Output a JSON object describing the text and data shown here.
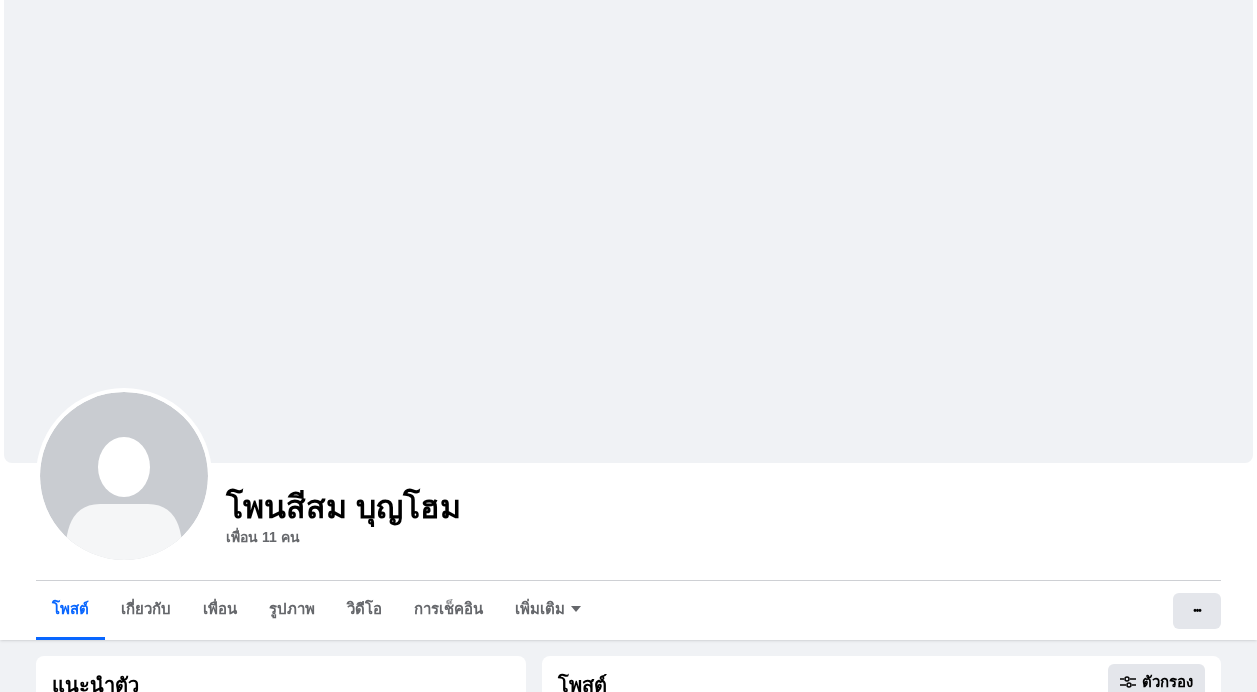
{
  "profile": {
    "name": "โพนสีสม บุญโฮม",
    "friends_count": "เพื่อน 11 คน"
  },
  "tabs": [
    {
      "label": "โพสต์",
      "selected": true
    },
    {
      "label": "เกี่ยวกับ",
      "selected": false
    },
    {
      "label": "เพื่อน",
      "selected": false
    },
    {
      "label": "รูปภาพ",
      "selected": false
    },
    {
      "label": "วิดีโอ",
      "selected": false
    },
    {
      "label": "การเช็คอิน",
      "selected": false
    },
    {
      "label": "เพิ่มเติม",
      "selected": false,
      "kind": "dropdown"
    }
  ],
  "more_button": {
    "label": "•••"
  },
  "intro_card": {
    "title": "แนะนำตัว"
  },
  "posts_card": {
    "title": "โพสต์",
    "filter_button": "ตัวกรอง"
  }
}
